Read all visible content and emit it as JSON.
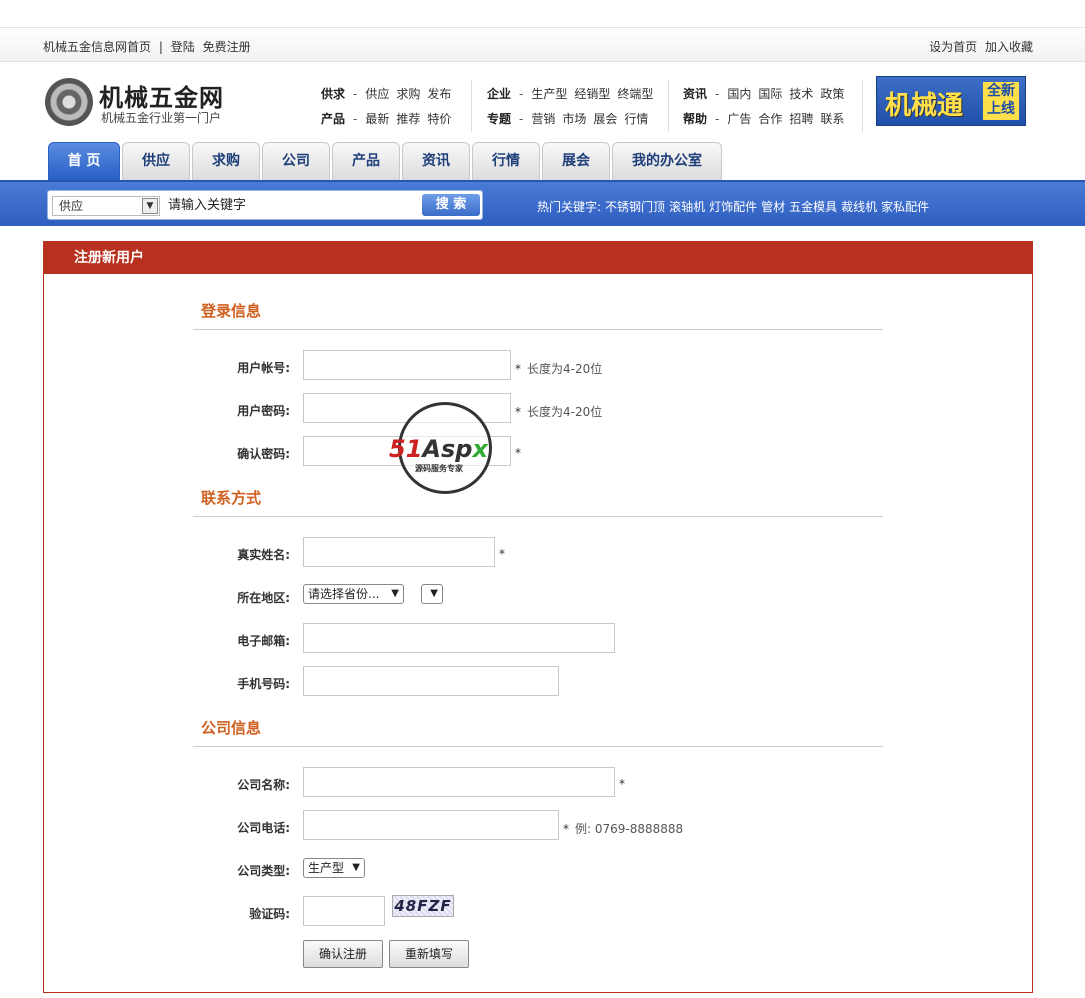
{
  "topbar": {
    "home_link": "机械五金信息网首页",
    "separator": "|",
    "login": "登陆",
    "register": "免费注册",
    "set_home": "设为首页",
    "favorite": "加入收藏"
  },
  "logo": {
    "title": "机械五金网",
    "subtitle": "机械五金行业第一门户"
  },
  "nav": {
    "groups": [
      {
        "rows": [
          {
            "head": "供求",
            "links": [
              "供应",
              "求购",
              "发布"
            ]
          },
          {
            "head": "产品",
            "links": [
              "最新",
              "推荐",
              "特价"
            ]
          }
        ]
      },
      {
        "rows": [
          {
            "head": "企业",
            "links": [
              "生产型",
              "经销型",
              "终端型"
            ]
          },
          {
            "head": "专题",
            "links": [
              "营销",
              "市场",
              "展会",
              "行情"
            ]
          }
        ]
      },
      {
        "rows": [
          {
            "head": "资讯",
            "links": [
              "国内",
              "国际",
              "技术",
              "政策"
            ]
          },
          {
            "head": "帮助",
            "links": [
              "广告",
              "合作",
              "招聘",
              "联系"
            ]
          }
        ]
      }
    ],
    "dash": "-"
  },
  "banner": {
    "title": "机械通",
    "badge_line1": "全新",
    "badge_line2": "上线"
  },
  "tabs": [
    "首 页",
    "供应",
    "求购",
    "公司",
    "产品",
    "资讯",
    "行情",
    "展会",
    "我的办公室"
  ],
  "search": {
    "category": "供应",
    "placeholder": "请输入关键字",
    "button": "搜 索",
    "hot_label": "热门关键字:",
    "hot_keywords": [
      "不锈钢门顶",
      "滚轴机",
      "灯饰配件",
      "管材",
      "五金模具",
      "裁线机",
      "家私配件"
    ]
  },
  "panel": {
    "title": "注册新用户",
    "sections": {
      "login": "登录信息",
      "contact": "联系方式",
      "company": "公司信息"
    },
    "fields": {
      "username": {
        "label": "用户帐号:",
        "note": "长度为4-20位"
      },
      "password": {
        "label": "用户密码:",
        "note": "长度为4-20位"
      },
      "confirm": {
        "label": "确认密码:"
      },
      "realname": {
        "label": "真实姓名:"
      },
      "region": {
        "label": "所在地区:",
        "province": "请选择省份..."
      },
      "email": {
        "label": "电子邮箱:"
      },
      "mobile": {
        "label": "手机号码:"
      },
      "company_name": {
        "label": "公司名称:"
      },
      "company_phone": {
        "label": "公司电话:",
        "note": "例: 0769-8888888"
      },
      "company_type": {
        "label": "公司类型:",
        "value": "生产型"
      },
      "captcha": {
        "label": "验证码:",
        "code": "48FZF"
      }
    },
    "required_mark": "*",
    "submit": "确认注册",
    "reset": "重新填写"
  },
  "watermark": {
    "brand_num": "51",
    "brand_a": "A",
    "brand_rest": "sp",
    "brand_x": "x",
    "sub": "源码服务专家"
  }
}
